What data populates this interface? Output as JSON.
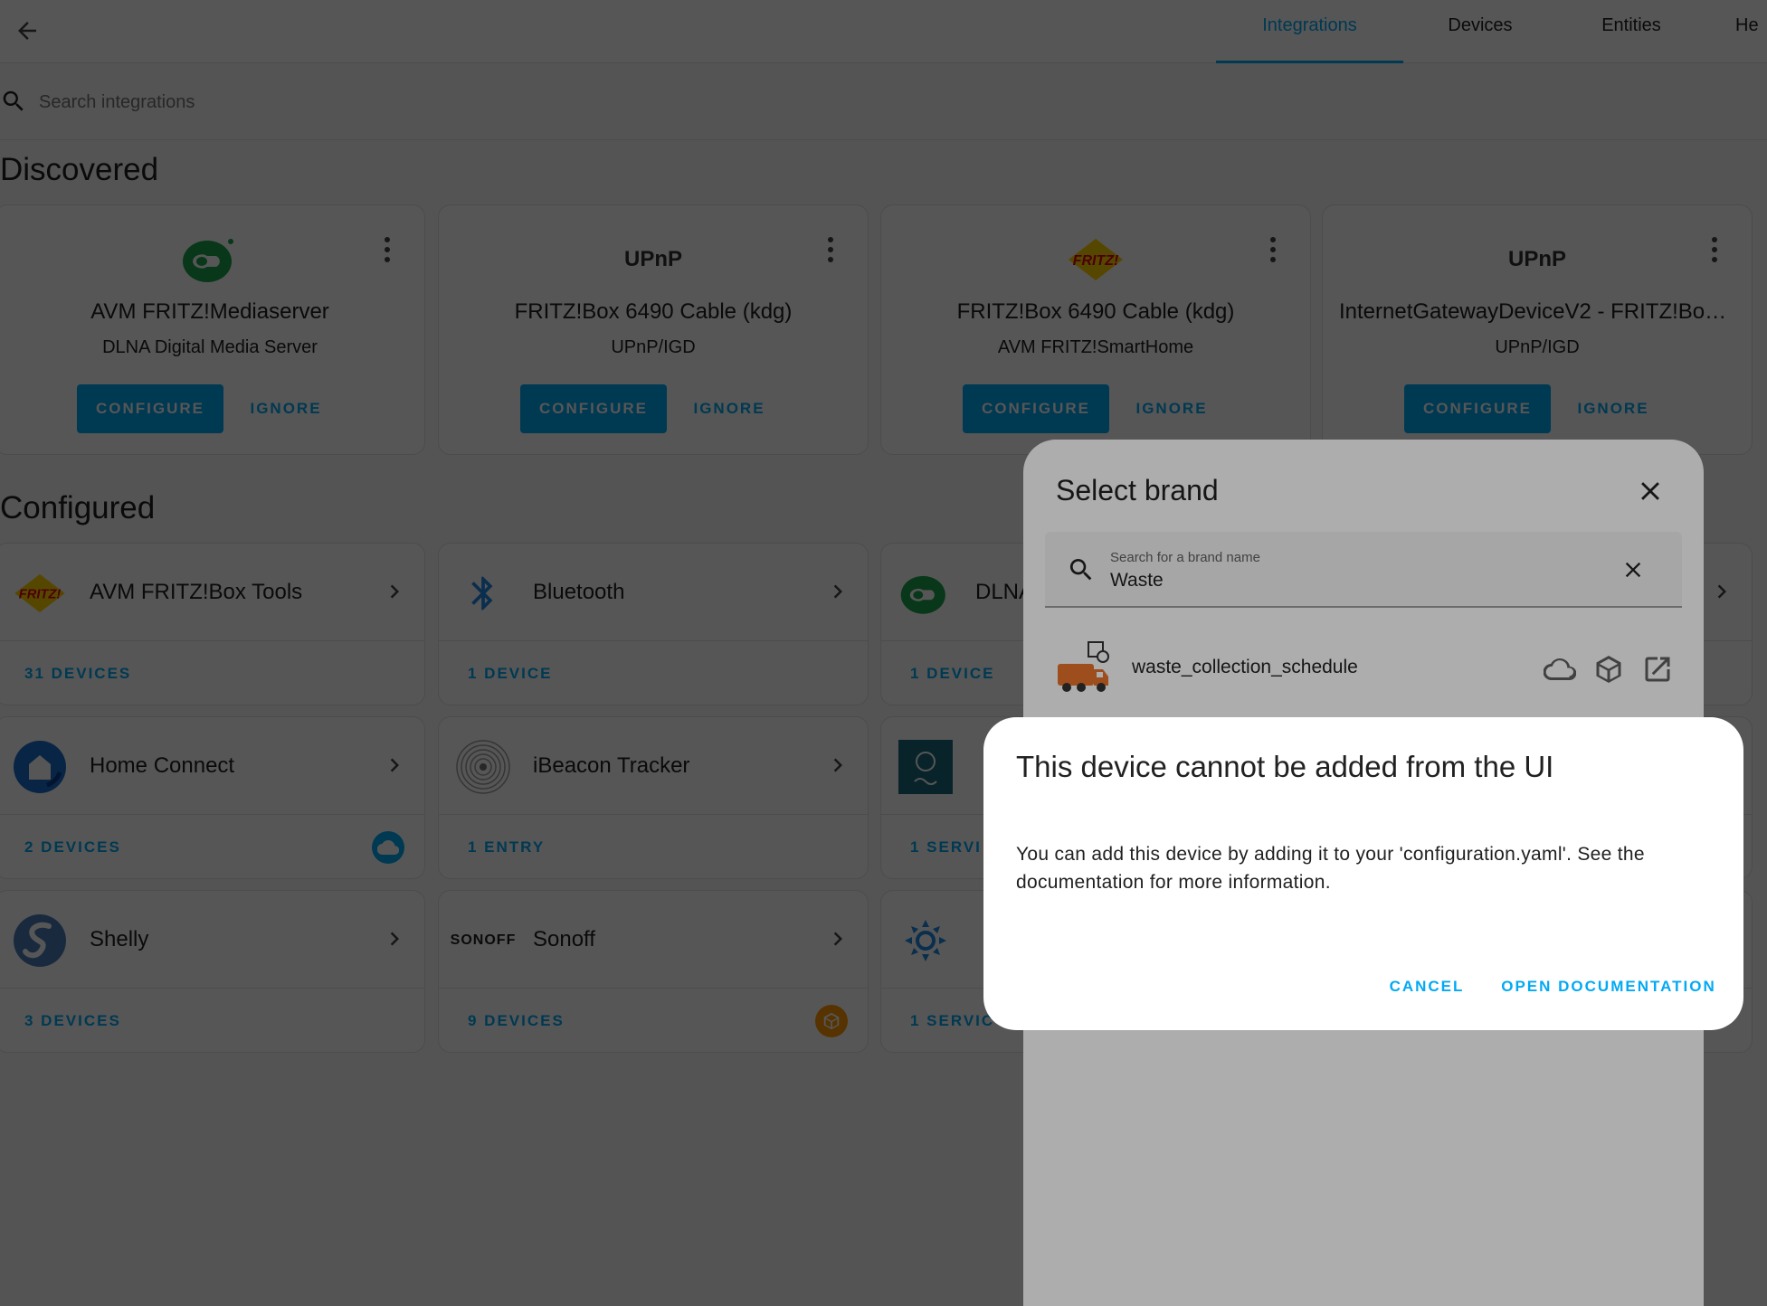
{
  "tabs": [
    "Integrations",
    "Devices",
    "Entities",
    "He"
  ],
  "search": {
    "placeholder": "Search integrations"
  },
  "sections": {
    "discovered": "Discovered",
    "configured": "Configured"
  },
  "discovered": [
    {
      "title": "AVM FRITZ!Mediaserver",
      "subtitle": "DLNA Digital Media Server",
      "logo": "dlna-logo",
      "configure": "CONFIGURE",
      "ignore": "IGNORE"
    },
    {
      "title": "FRITZ!Box 6490 Cable (kdg)",
      "subtitle": "UPnP/IGD",
      "logo": "upnp-logo",
      "logo_text": "UPnP",
      "configure": "CONFIGURE",
      "ignore": "IGNORE"
    },
    {
      "title": "FRITZ!Box 6490 Cable (kdg)",
      "subtitle": "AVM FRITZ!SmartHome",
      "logo": "fritz-logo",
      "configure": "CONFIGURE",
      "ignore": "IGNORE"
    },
    {
      "title": "InternetGatewayDeviceV2 - FRITZ!Box ...",
      "subtitle": "UPnP/IGD",
      "logo": "upnp-logo",
      "logo_text": "UPnP",
      "configure": "CONFIGURE",
      "ignore": "IGNORE"
    }
  ],
  "configured": [
    {
      "name": "AVM FRITZ!Box Tools",
      "count": "31 DEVICES",
      "logo": "fritz-logo"
    },
    {
      "name": "Bluetooth",
      "count": "1 DEVICE",
      "logo": "bluetooth-icon"
    },
    {
      "name": "DLNA",
      "count": "1 DEVICE",
      "logo": "dlna-logo"
    },
    {
      "name": "Home Connect",
      "count": "2 DEVICES",
      "logo": "home-connect-logo",
      "badge": "cloud-icon"
    },
    {
      "name": "iBeacon Tracker",
      "count": "1 ENTRY",
      "logo": "ibeacon-logo"
    },
    {
      "name": "",
      "count": "1 SERVI",
      "logo": "integration-logo"
    },
    {
      "name": "Shelly",
      "count": "3 DEVICES",
      "logo": "shelly-logo"
    },
    {
      "name": "Sonoff",
      "count": "9 DEVICES",
      "logo": "sonoff-logo",
      "logo_text": "SONOFF",
      "badge": "custom-component-icon"
    },
    {
      "name": "",
      "count": "1 SERVIC",
      "logo": "sun-logo"
    }
  ],
  "brand_dialog": {
    "title": "Select brand",
    "search_label": "Search for a brand name",
    "search_value": "Waste",
    "results": [
      {
        "name": "waste_collection_schedule",
        "icons": [
          "cloud-icon",
          "custom-component-icon",
          "open-external-icon"
        ]
      }
    ]
  },
  "alert": {
    "title": "This device cannot be added from the UI",
    "body": "You can add this device by adding it to your 'configuration.yaml'. See the documentation for more information.",
    "cancel": "CANCEL",
    "open_docs": "OPEN DOCUMENTATION"
  },
  "colors": {
    "primary": "#03a9f4",
    "custom_badge": "#ff9800",
    "text": "#212121"
  }
}
